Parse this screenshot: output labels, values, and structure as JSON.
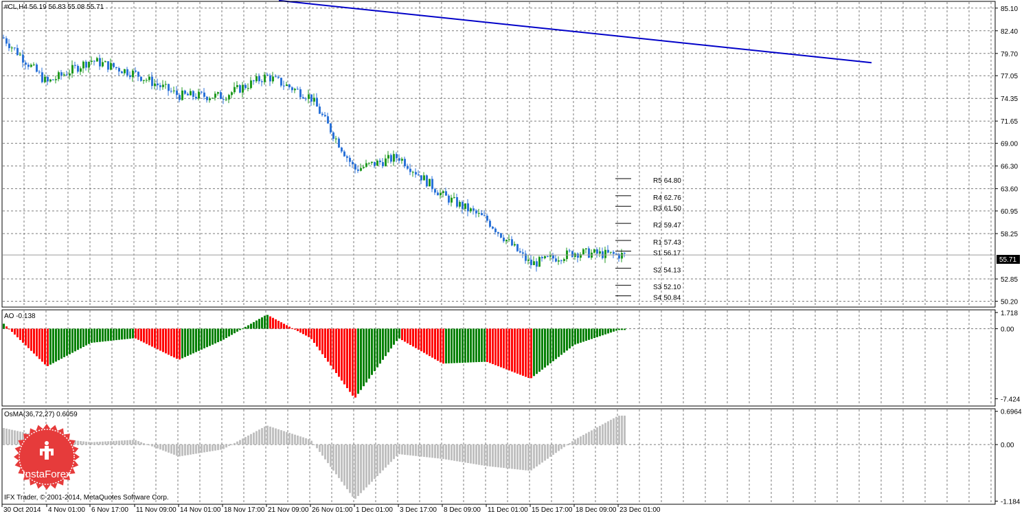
{
  "header": {
    "symbol_line": "#CL,H4  56.19 56.83 55.08 55.71",
    "current_price_label": "55.71"
  },
  "colors": {
    "bull_candle": "#1f9a1f",
    "bear_candle": "#2a72d8",
    "trendline": "#0000c8",
    "ao_up": "#008000",
    "ao_down": "#ff0000",
    "osma": "#c0c0c0",
    "price_tag_bg": "#000000",
    "price_tag_fg": "#ffffff",
    "logo": "#e63b3b"
  },
  "footer": {
    "copyright": "IFX Trader, © 2001-2014, MetaQuotes Software Corp."
  },
  "logo": {
    "text": "InstaForex",
    "icon_name": "instaforex-logo-icon"
  },
  "chart_data": [
    {
      "type": "candlestick",
      "panel": "price",
      "title": "#CL,H4  56.19 56.83 55.08 55.71",
      "ylim": [
        49.5,
        85.9
      ],
      "y_ticks": [
        "85.10",
        "82.40",
        "79.70",
        "77.05",
        "74.35",
        "71.65",
        "69.00",
        "66.30",
        "63.60",
        "60.95",
        "58.25",
        "52.85",
        "50.20"
      ],
      "x_ticks": [
        "30 Oct 2014",
        "4 Nov 01:00",
        "6 Nov 17:00",
        "11 Nov 09:00",
        "14 Nov 01:00",
        "18 Nov 17:00",
        "21 Nov 09:00",
        "26 Nov 01:00",
        "1 Dec 01:00",
        "3 Dec 17:00",
        "8 Dec 09:00",
        "11 Dec 01:00",
        "15 Dec 17:00",
        "18 Dec 09:00",
        "23 Dec 01:00"
      ],
      "grid": true,
      "current_price": 55.71,
      "last_bar": {
        "open": 56.19,
        "high": 56.83,
        "low": 55.08,
        "close": 55.71
      },
      "close_path": [
        {
          "x": "30 Oct 2014",
          "close": 81.6
        },
        {
          "x": "4 Nov 01:00",
          "close": 76.2
        },
        {
          "x": "6 Nov 17:00",
          "close": 78.9
        },
        {
          "x": "11 Nov 09:00",
          "close": 77.3
        },
        {
          "x": "14 Nov 01:00",
          "close": 74.7
        },
        {
          "x": "18 Nov 17:00",
          "close": 74.6
        },
        {
          "x": "21 Nov 09:00",
          "close": 77.0
        },
        {
          "x": "26 Nov 01:00",
          "close": 74.5
        },
        {
          "x": "1 Dec 01:00",
          "close": 65.9
        },
        {
          "x": "3 Dec 17:00",
          "close": 67.4
        },
        {
          "x": "8 Dec 09:00",
          "close": 62.8
        },
        {
          "x": "11 Dec 01:00",
          "close": 59.9
        },
        {
          "x": "15 Dec 17:00",
          "close": 54.6
        },
        {
          "x": "18 Dec 09:00",
          "close": 56.0
        },
        {
          "x": "23 Dec 01:00",
          "close": 55.71
        }
      ],
      "trendline": [
        {
          "x": "21 Nov 09:00",
          "y": 86.0
        },
        {
          "x_index": 35,
          "y": 78.6
        }
      ],
      "pivot_levels": [
        {
          "label": "R5",
          "value_text": "64.80",
          "value": 64.8
        },
        {
          "label": "R4",
          "value_text": "62.76",
          "value": 62.76
        },
        {
          "label": "R3",
          "value_text": "61.50",
          "value": 61.5
        },
        {
          "label": "R2",
          "value_text": "59.47",
          "value": 59.47
        },
        {
          "label": "R1",
          "value_text": "57.43",
          "value": 57.43
        },
        {
          "label": "S1",
          "value_text": "56.17",
          "value": 56.17
        },
        {
          "label": "S2",
          "value_text": "54.13",
          "value": 54.13
        },
        {
          "label": "S3",
          "value_text": "52.10",
          "value": 52.1
        },
        {
          "label": "S4",
          "value_text": "50.84",
          "value": 50.84
        }
      ]
    },
    {
      "type": "histogram",
      "panel": "ao",
      "title": "AO -0.138",
      "ylim": [
        -8.2,
        2.0
      ],
      "y_ticks": [
        "1.718",
        "0.00",
        "-7.424"
      ],
      "last_value": -0.138,
      "profile": [
        {
          "x": "30 Oct 2014",
          "value": 0.6
        },
        {
          "x": "4 Nov 01:00",
          "value": -4.0
        },
        {
          "x": "6 Nov 17:00",
          "value": -1.5
        },
        {
          "x": "11 Nov 09:00",
          "value": -1.0
        },
        {
          "x": "14 Nov 01:00",
          "value": -3.3
        },
        {
          "x": "18 Nov 17:00",
          "value": -1.2
        },
        {
          "x": "21 Nov 09:00",
          "value": 1.5
        },
        {
          "x": "26 Nov 01:00",
          "value": -1.0
        },
        {
          "x": "1 Dec 01:00",
          "value": -7.4
        },
        {
          "x": "3 Dec 17:00",
          "value": -1.0
        },
        {
          "x": "8 Dec 09:00",
          "value": -3.7
        },
        {
          "x": "11 Dec 01:00",
          "value": -3.5
        },
        {
          "x": "15 Dec 17:00",
          "value": -5.3
        },
        {
          "x": "18 Dec 09:00",
          "value": -1.7
        },
        {
          "x": "23 Dec 01:00",
          "value": -0.138
        }
      ]
    },
    {
      "type": "histogram",
      "panel": "osma",
      "title": "OsMA(36,72,27) 0.6059",
      "ylim": [
        -1.25,
        0.75
      ],
      "y_ticks": [
        "0.6964",
        "0.00",
        "-1.184"
      ],
      "last_value": 0.6059,
      "profile": [
        {
          "x": "30 Oct 2014",
          "value": 0.35
        },
        {
          "x": "4 Nov 01:00",
          "value": 0.15
        },
        {
          "x": "6 Nov 17:00",
          "value": 0.05
        },
        {
          "x": "11 Nov 09:00",
          "value": 0.1
        },
        {
          "x": "14 Nov 01:00",
          "value": -0.25
        },
        {
          "x": "18 Nov 17:00",
          "value": -0.1
        },
        {
          "x": "21 Nov 09:00",
          "value": 0.4
        },
        {
          "x": "26 Nov 01:00",
          "value": 0.1
        },
        {
          "x": "1 Dec 01:00",
          "value": -1.15
        },
        {
          "x": "3 Dec 17:00",
          "value": -0.2
        },
        {
          "x": "8 Dec 09:00",
          "value": -0.3
        },
        {
          "x": "11 Dec 01:00",
          "value": -0.45
        },
        {
          "x": "15 Dec 17:00",
          "value": -0.55
        },
        {
          "x": "18 Dec 09:00",
          "value": 0.1
        },
        {
          "x": "23 Dec 01:00",
          "value": 0.6059
        }
      ]
    }
  ]
}
